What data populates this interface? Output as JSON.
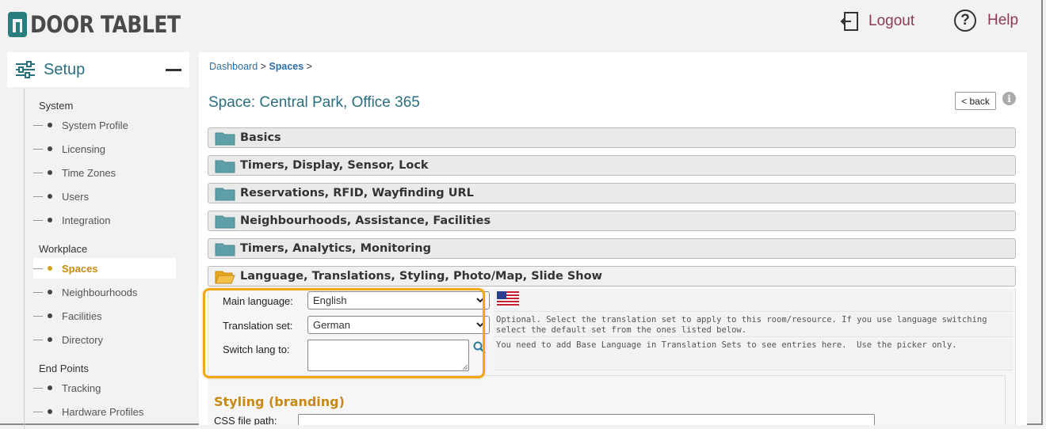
{
  "header": {
    "logo_text": "DOOR TABLET",
    "logout_label": "Logout",
    "help_label": "Help",
    "help_symbol": "?"
  },
  "sidebar": {
    "title": "Setup",
    "sections": [
      {
        "title": "System",
        "items": [
          "System Profile",
          "Licensing",
          "Time Zones",
          "Users",
          "Integration"
        ]
      },
      {
        "title": "Workplace",
        "items": [
          "Spaces",
          "Neighbourhoods",
          "Facilities",
          "Directory"
        ]
      },
      {
        "title": "End Points",
        "items": [
          "Tracking",
          "Hardware Profiles"
        ]
      }
    ],
    "active_item": "Spaces"
  },
  "breadcrumb": {
    "dashboard": "Dashboard",
    "sep1": " > ",
    "spaces": "Spaces",
    "sep2": " >"
  },
  "page": {
    "title": "Space: Central Park, Office 365",
    "back_label": "< back",
    "info_symbol": "i"
  },
  "sections": [
    "Basics",
    "Timers, Display, Sensor, Lock",
    "Reservations, RFID, Wayfinding URL",
    "Neighbourhoods, Assistance, Facilities",
    "Timers, Analytics, Monitoring",
    "Language, Translations, Styling, Photo/Map, Slide Show"
  ],
  "language_form": {
    "main_language_label": "Main language:",
    "main_language_value": "English",
    "translation_set_label": "Translation set:",
    "translation_set_value": "German",
    "switch_lang_label": "Switch lang to:",
    "translation_help": "Optional. Select the translation set to apply to this room/resource. If you use language switching\nselect the default set from the ones listed below.",
    "switch_help": "You need to add Base Language in Translation Sets to see entries here.  Use the picker only."
  },
  "styling": {
    "heading": "Styling (branding)",
    "css_label": "CSS file path:"
  },
  "colors": {
    "accent_teal": "#2a6f7f",
    "link_blue": "#2a6fa8",
    "header_link": "#8b3a5a",
    "highlight": "#f0a818",
    "active": "#c88a10"
  }
}
